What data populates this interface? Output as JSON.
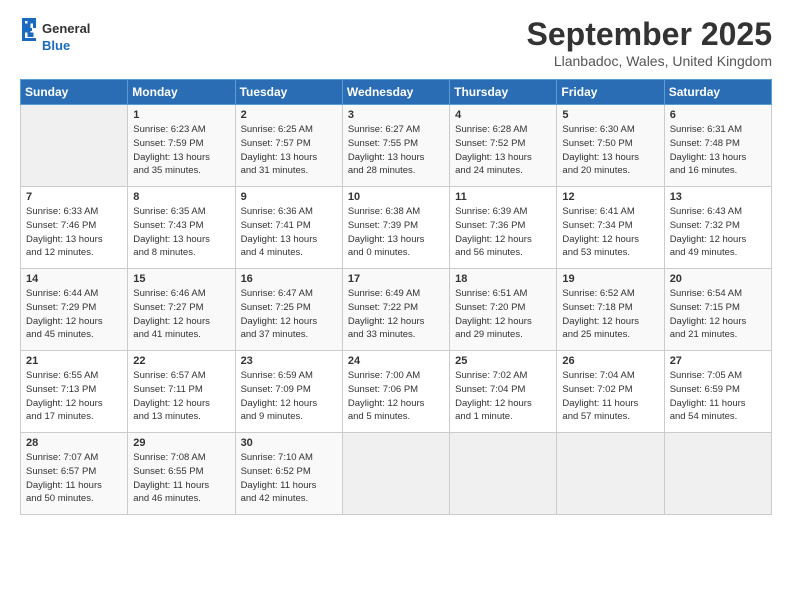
{
  "header": {
    "logo_line1": "General",
    "logo_line2": "Blue",
    "month": "September 2025",
    "location": "Llanbadoc, Wales, United Kingdom"
  },
  "weekdays": [
    "Sunday",
    "Monday",
    "Tuesday",
    "Wednesday",
    "Thursday",
    "Friday",
    "Saturday"
  ],
  "weeks": [
    [
      {
        "day": "",
        "text": ""
      },
      {
        "day": "1",
        "text": "Sunrise: 6:23 AM\nSunset: 7:59 PM\nDaylight: 13 hours\nand 35 minutes."
      },
      {
        "day": "2",
        "text": "Sunrise: 6:25 AM\nSunset: 7:57 PM\nDaylight: 13 hours\nand 31 minutes."
      },
      {
        "day": "3",
        "text": "Sunrise: 6:27 AM\nSunset: 7:55 PM\nDaylight: 13 hours\nand 28 minutes."
      },
      {
        "day": "4",
        "text": "Sunrise: 6:28 AM\nSunset: 7:52 PM\nDaylight: 13 hours\nand 24 minutes."
      },
      {
        "day": "5",
        "text": "Sunrise: 6:30 AM\nSunset: 7:50 PM\nDaylight: 13 hours\nand 20 minutes."
      },
      {
        "day": "6",
        "text": "Sunrise: 6:31 AM\nSunset: 7:48 PM\nDaylight: 13 hours\nand 16 minutes."
      }
    ],
    [
      {
        "day": "7",
        "text": "Sunrise: 6:33 AM\nSunset: 7:46 PM\nDaylight: 13 hours\nand 12 minutes."
      },
      {
        "day": "8",
        "text": "Sunrise: 6:35 AM\nSunset: 7:43 PM\nDaylight: 13 hours\nand 8 minutes."
      },
      {
        "day": "9",
        "text": "Sunrise: 6:36 AM\nSunset: 7:41 PM\nDaylight: 13 hours\nand 4 minutes."
      },
      {
        "day": "10",
        "text": "Sunrise: 6:38 AM\nSunset: 7:39 PM\nDaylight: 13 hours\nand 0 minutes."
      },
      {
        "day": "11",
        "text": "Sunrise: 6:39 AM\nSunset: 7:36 PM\nDaylight: 12 hours\nand 56 minutes."
      },
      {
        "day": "12",
        "text": "Sunrise: 6:41 AM\nSunset: 7:34 PM\nDaylight: 12 hours\nand 53 minutes."
      },
      {
        "day": "13",
        "text": "Sunrise: 6:43 AM\nSunset: 7:32 PM\nDaylight: 12 hours\nand 49 minutes."
      }
    ],
    [
      {
        "day": "14",
        "text": "Sunrise: 6:44 AM\nSunset: 7:29 PM\nDaylight: 12 hours\nand 45 minutes."
      },
      {
        "day": "15",
        "text": "Sunrise: 6:46 AM\nSunset: 7:27 PM\nDaylight: 12 hours\nand 41 minutes."
      },
      {
        "day": "16",
        "text": "Sunrise: 6:47 AM\nSunset: 7:25 PM\nDaylight: 12 hours\nand 37 minutes."
      },
      {
        "day": "17",
        "text": "Sunrise: 6:49 AM\nSunset: 7:22 PM\nDaylight: 12 hours\nand 33 minutes."
      },
      {
        "day": "18",
        "text": "Sunrise: 6:51 AM\nSunset: 7:20 PM\nDaylight: 12 hours\nand 29 minutes."
      },
      {
        "day": "19",
        "text": "Sunrise: 6:52 AM\nSunset: 7:18 PM\nDaylight: 12 hours\nand 25 minutes."
      },
      {
        "day": "20",
        "text": "Sunrise: 6:54 AM\nSunset: 7:15 PM\nDaylight: 12 hours\nand 21 minutes."
      }
    ],
    [
      {
        "day": "21",
        "text": "Sunrise: 6:55 AM\nSunset: 7:13 PM\nDaylight: 12 hours\nand 17 minutes."
      },
      {
        "day": "22",
        "text": "Sunrise: 6:57 AM\nSunset: 7:11 PM\nDaylight: 12 hours\nand 13 minutes."
      },
      {
        "day": "23",
        "text": "Sunrise: 6:59 AM\nSunset: 7:09 PM\nDaylight: 12 hours\nand 9 minutes."
      },
      {
        "day": "24",
        "text": "Sunrise: 7:00 AM\nSunset: 7:06 PM\nDaylight: 12 hours\nand 5 minutes."
      },
      {
        "day": "25",
        "text": "Sunrise: 7:02 AM\nSunset: 7:04 PM\nDaylight: 12 hours\nand 1 minute."
      },
      {
        "day": "26",
        "text": "Sunrise: 7:04 AM\nSunset: 7:02 PM\nDaylight: 11 hours\nand 57 minutes."
      },
      {
        "day": "27",
        "text": "Sunrise: 7:05 AM\nSunset: 6:59 PM\nDaylight: 11 hours\nand 54 minutes."
      }
    ],
    [
      {
        "day": "28",
        "text": "Sunrise: 7:07 AM\nSunset: 6:57 PM\nDaylight: 11 hours\nand 50 minutes."
      },
      {
        "day": "29",
        "text": "Sunrise: 7:08 AM\nSunset: 6:55 PM\nDaylight: 11 hours\nand 46 minutes."
      },
      {
        "day": "30",
        "text": "Sunrise: 7:10 AM\nSunset: 6:52 PM\nDaylight: 11 hours\nand 42 minutes."
      },
      {
        "day": "",
        "text": ""
      },
      {
        "day": "",
        "text": ""
      },
      {
        "day": "",
        "text": ""
      },
      {
        "day": "",
        "text": ""
      }
    ]
  ]
}
